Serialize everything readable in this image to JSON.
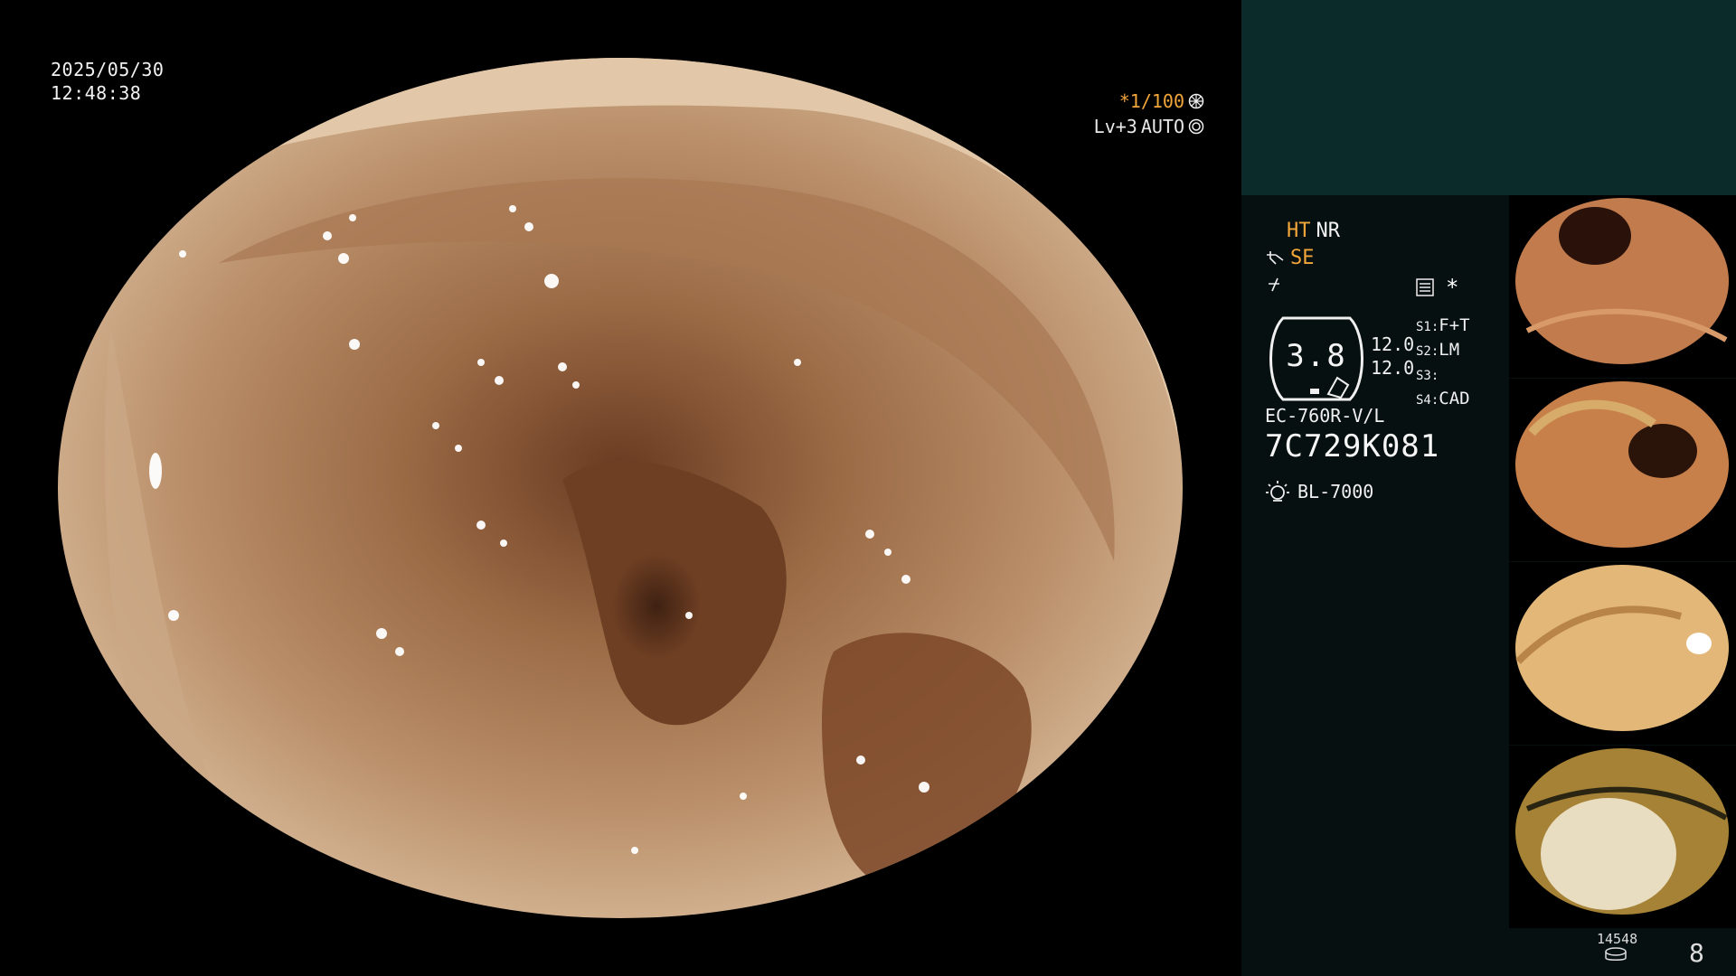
{
  "overlay": {
    "date": "2025/05/30",
    "time": "12:48:38",
    "shutter": "*1/100",
    "level": "Lv+3",
    "iris": "AUTO"
  },
  "panel": {
    "ht": "HT",
    "nr": "NR",
    "se": "SE",
    "zoom_value": "3.8",
    "scale_top": "12.0",
    "scale_bottom": "12.0",
    "settings": [
      {
        "key": "S1:",
        "value": "F+T"
      },
      {
        "key": "S2:",
        "value": "LM"
      },
      {
        "key": "S3:",
        "value": ""
      },
      {
        "key": "S4:",
        "value": "CAD"
      }
    ],
    "scope_model": "EC-760R-V/L",
    "serial": "7C729K081",
    "light_source": "BL-7000"
  },
  "footer": {
    "counter_label": "14548",
    "image_count": "8"
  },
  "icons": {
    "aperture": "aperture-icon",
    "iris": "iris-icon",
    "enhance": "enhance-icon",
    "mode": "mode-icon",
    "menu": "menu-icon",
    "light": "light-bulb-icon",
    "disk": "disk-icon"
  },
  "colors": {
    "accent_orange": "#f3a63a",
    "panel_bg": "#061010",
    "panel_top": "#0b2a2a"
  }
}
